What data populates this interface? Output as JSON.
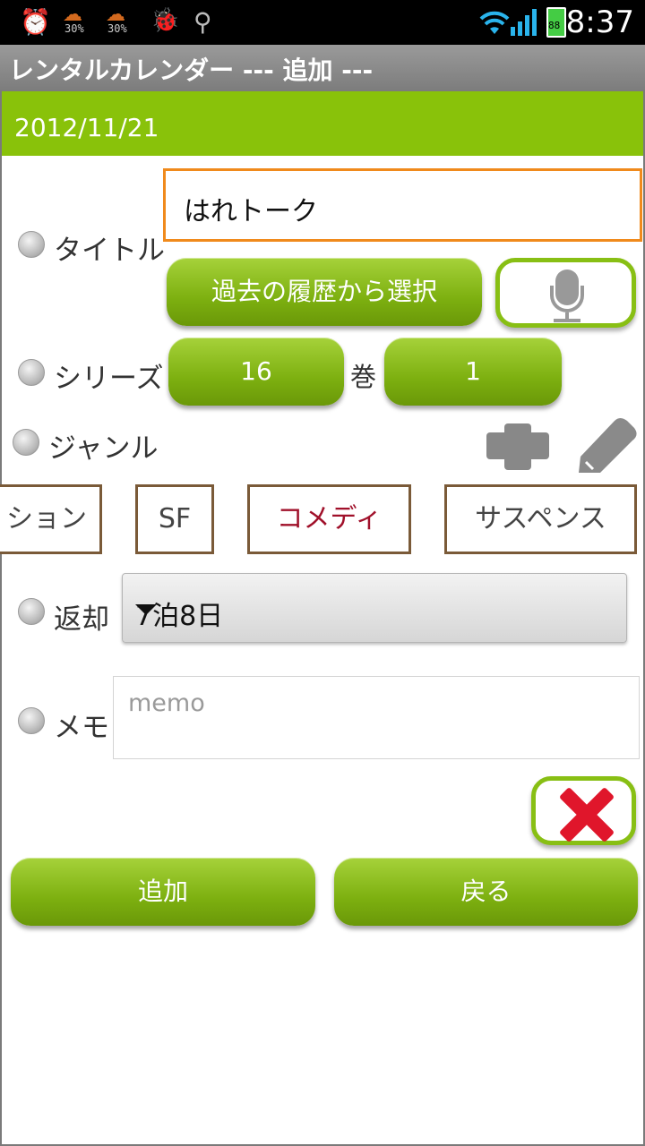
{
  "status_bar": {
    "weather1_pct": "30%",
    "weather2_pct": "30%",
    "time": "8:37",
    "battery_label": "88"
  },
  "app": {
    "title": "レンタルカレンダー --- 追加 ---"
  },
  "date": "2012/11/21",
  "title_section": {
    "label": "タイトル",
    "value": "はれトーク",
    "history_button": "過去の履歴から選択"
  },
  "series_section": {
    "label": "シリーズ",
    "volume_count": "16",
    "volume_unit": "巻",
    "volume_number": "1"
  },
  "genre_section": {
    "label": "ジャンル",
    "genres": [
      "ション",
      "SF",
      "コメディ",
      "サスペンス"
    ]
  },
  "return_section": {
    "label": "返却",
    "selected": "7泊8日"
  },
  "memo_section": {
    "label": "メモ",
    "placeholder": "memo"
  },
  "actions": {
    "add": "追加",
    "back": "戻る"
  },
  "colors": {
    "accent_green": "#89c20a",
    "focus_orange": "#f08a1c",
    "selected_genre": "#a0102a",
    "clear_red": "#e0162b"
  }
}
